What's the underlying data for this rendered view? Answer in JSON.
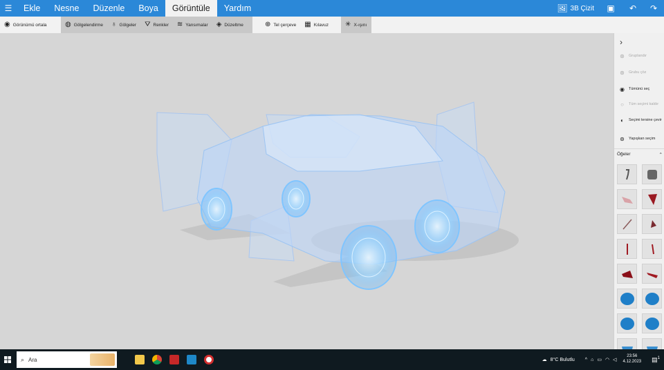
{
  "menubar": {
    "hamburger_icon": "hamburger-icon",
    "items": [
      "Ekle",
      "Nesne",
      "Düzenle",
      "Boya",
      "Görüntüle",
      "Yardım"
    ],
    "active_index": 4,
    "view3d_label": "3B Çizit",
    "accent_color": "#2b88d8"
  },
  "toolbar": {
    "center_view": "Görünümü ortala",
    "shading": "Gölgelendirme",
    "shadows": "Gölgeler",
    "colors": "Renkler",
    "reflections": "Yansımalar",
    "smoothing": "Düzeltme",
    "wireframe": "Tel çerçeve",
    "guide": "Kılavuz",
    "xray": "X-ışını"
  },
  "panel": {
    "group": "Gruplandır",
    "ungroup": "Grubu çöz",
    "select_all": "Tümünü seç",
    "deselect_all": "Tüm seçimi kaldır",
    "invert_selection": "Seçimi tersine çevir",
    "sticky_selection": "Yapışkan seçim",
    "items_header": "Öğeler"
  },
  "taskbar": {
    "search_text": "Ara",
    "weather": "8°C  Bulutlu",
    "time": "23:56",
    "date": "4.12.2023",
    "notification_count": "1"
  }
}
